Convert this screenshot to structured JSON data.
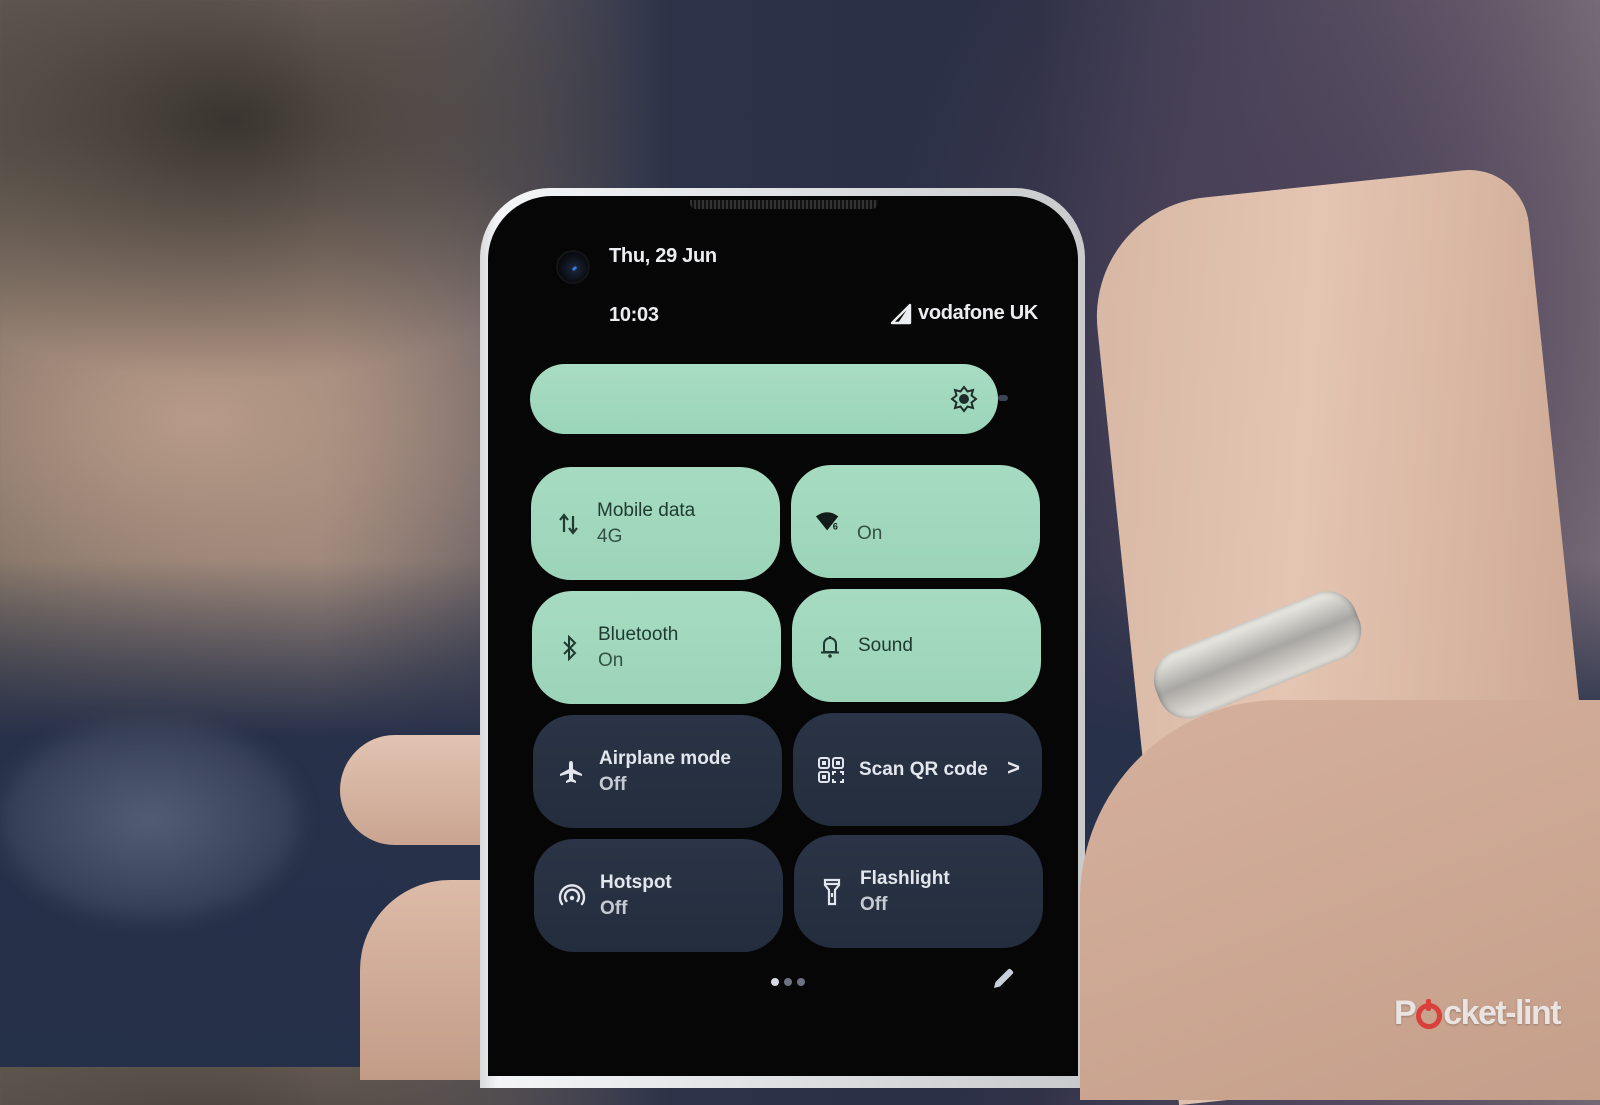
{
  "status_bar": {
    "date": "Thu, 29 Jun",
    "time": "10:03",
    "carrier": "vodafone UK",
    "signal_icon": "signal-triangle-icon"
  },
  "brightness": {
    "icon": "brightness-icon",
    "level_percent": 95
  },
  "tiles": [
    {
      "id": "mobile-data",
      "label": "Mobile data",
      "sub": "4G",
      "state": "on",
      "icon": "mobile-data-arrows-icon"
    },
    {
      "id": "wifi",
      "label": "",
      "sub": "On",
      "state": "on",
      "icon": "wifi-6-icon",
      "badge": "6"
    },
    {
      "id": "bluetooth",
      "label": "Bluetooth",
      "sub": "On",
      "state": "on",
      "icon": "bluetooth-icon"
    },
    {
      "id": "sound",
      "label": "Sound",
      "sub": "",
      "state": "on",
      "icon": "bell-icon"
    },
    {
      "id": "airplane",
      "label": "Airplane mode",
      "sub": "Off",
      "state": "off",
      "icon": "airplane-icon"
    },
    {
      "id": "qr",
      "label": "Scan QR code",
      "sub": "",
      "state": "off",
      "icon": "qr-code-icon",
      "chevron": ">"
    },
    {
      "id": "hotspot",
      "label": "Hotspot",
      "sub": "Off",
      "state": "off",
      "icon": "hotspot-icon"
    },
    {
      "id": "flashlight",
      "label": "Flashlight",
      "sub": "Off",
      "state": "off",
      "icon": "flashlight-icon"
    }
  ],
  "pager": {
    "pages": 3,
    "current": 1
  },
  "edit_icon": "pencil-icon",
  "watermark": {
    "text_before": "P",
    "text_after": "cket-lint"
  },
  "colors": {
    "tile_on": "#a6dbc1",
    "tile_off": "#2a3446",
    "screen_bg": "#060606",
    "watermark_accent": "#d8413b"
  }
}
